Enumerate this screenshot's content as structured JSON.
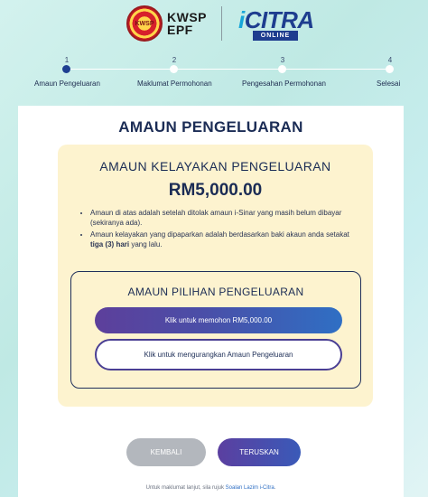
{
  "header": {
    "kwsp_line1": "KWSP",
    "kwsp_line2": "EPF",
    "emblem_text": "KWSP",
    "citra_i": "i",
    "citra_word": "CITRA",
    "citra_online": "ONLINE"
  },
  "stepper": {
    "steps": [
      {
        "number": "1",
        "label": "Amaun Pengeluaran",
        "active": true
      },
      {
        "number": "2",
        "label": "Maklumat Permohonan",
        "active": false
      },
      {
        "number": "3",
        "label": "Pengesahan Permohonan",
        "active": false
      },
      {
        "number": "4",
        "label": "Selesai",
        "active": false
      }
    ]
  },
  "main": {
    "title": "AMAUN PENGELUARAN",
    "eligibility": {
      "title": "AMAUN KELAYAKAN PENGELUARAN",
      "amount": "RM5,000.00",
      "note1": "Amaun di atas adalah setelah ditolak amaun i-Sinar yang masih belum dibayar (sekiranya ada).",
      "note2_before": "Amaun kelayakan yang dipaparkan adalah berdasarkan baki akaun anda setakat ",
      "note2_bold": "tiga (3) hari",
      "note2_after": " yang lalu."
    },
    "choice": {
      "title": "AMAUN PILIHAN PENGELUARAN",
      "apply_button": "Klik untuk memohon RM5,000.00",
      "reduce_button": "Klik untuk mengurangkan Amaun Pengeluaran"
    },
    "back_button": "KEMBALI",
    "next_button": "TERUSKAN",
    "footer_text": "Untuk maklumat lanjut, sila rujuk ",
    "footer_link": "Soalan Lazim i-Citra",
    "footer_end": "."
  },
  "colors": {
    "accent_navy": "#1e3f91",
    "gradient_purple": "#5d3f9b",
    "gradient_blue": "#2f6fc4",
    "yellow_panel": "#fdf3cf",
    "back_grey": "#b3b7bd"
  }
}
